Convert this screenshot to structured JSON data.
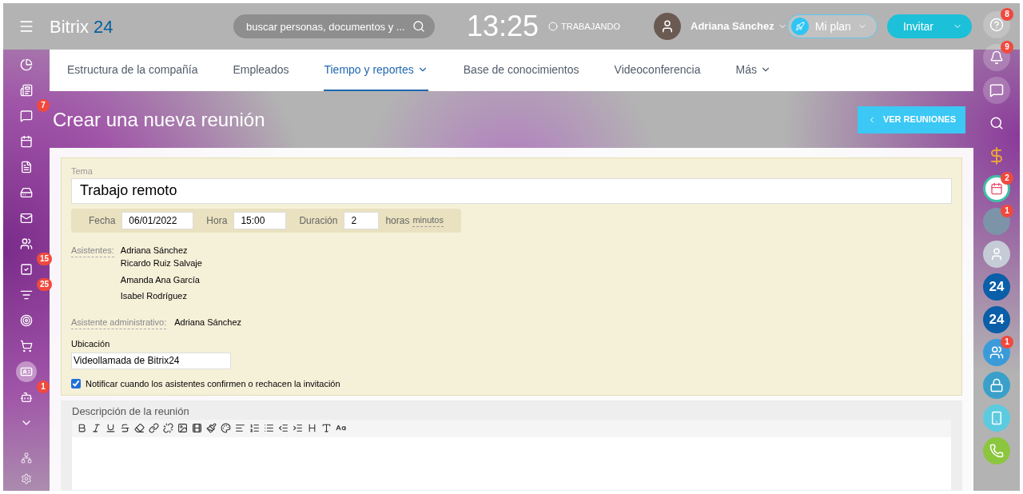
{
  "header": {
    "logo_text": "Bitrix",
    "logo_accent": "24",
    "search": {
      "placeholder": "buscar personas, documentos y ..."
    },
    "clock": "13:25",
    "status": "TRABAJANDO",
    "user": "Adriana Sánchez",
    "plan_button": "Mi plan",
    "invite_button": "Invitar"
  },
  "left_sidebar": {
    "items": [
      {
        "kind": "chart",
        "selected": false
      },
      {
        "kind": "feed",
        "selected": false
      },
      {
        "kind": "chat",
        "badge": "7",
        "selected": false
      },
      {
        "kind": "calendar",
        "selected": false
      },
      {
        "kind": "document",
        "selected": false
      },
      {
        "kind": "drive",
        "selected": false
      },
      {
        "kind": "mail",
        "selected": false
      },
      {
        "kind": "group",
        "selected": false
      },
      {
        "kind": "tasks",
        "badge": "15",
        "selected": false
      },
      {
        "kind": "filter",
        "badge": "25",
        "selected": false
      },
      {
        "kind": "target",
        "selected": false
      },
      {
        "kind": "cart",
        "selected": false
      },
      {
        "kind": "contact",
        "selected": true
      },
      {
        "kind": "robot",
        "badge": "1",
        "selected": false
      },
      {
        "kind": "more",
        "selected": false
      }
    ],
    "bottom": [
      {
        "kind": "network"
      },
      {
        "kind": "settings"
      }
    ]
  },
  "nav_tabs": [
    {
      "label": "Estructura de la compañía",
      "selected": false,
      "dropdown": false
    },
    {
      "label": "Empleados",
      "selected": false,
      "dropdown": false
    },
    {
      "label": "Tiempo y reportes",
      "selected": true,
      "dropdown": true
    },
    {
      "label": "Base de conocimientos",
      "selected": false,
      "dropdown": false
    },
    {
      "label": "Videoconferencia",
      "selected": false,
      "dropdown": false
    },
    {
      "label": "Más",
      "selected": false,
      "dropdown": true
    }
  ],
  "page_title": "Crear una nueva reunión",
  "view_button": "VER REUNIONES",
  "form": {
    "topic": {
      "label": "Tema",
      "value": "Trabajo remoto"
    },
    "date": {
      "label": "Fecha",
      "value": "06/01/2022"
    },
    "time": {
      "label": "Hora",
      "value": "15:00"
    },
    "duration": {
      "label": "Duración",
      "value": "2",
      "unit": "horas",
      "alt_unit": "minutos"
    },
    "attendees": {
      "label": "Asistentes:",
      "names": [
        "Adriana Sánchez",
        "Ricardo Ruiz Salvaje",
        "Amanda Ana García",
        "Isabel Rodríguez"
      ]
    },
    "assistant": {
      "label": "Asistente administrativo:",
      "value": "Adriana Sánchez"
    },
    "location": {
      "label": "Ubicación",
      "value": "Videollamada de Bitrix24"
    },
    "notify": {
      "label": "Notificar cuando los asistentes confirmen o rechacen la invitación",
      "checked": true
    },
    "description": {
      "label": "Descripción de la reunión"
    }
  },
  "right_sidebar": [
    {
      "kind": "help",
      "badge": "8"
    },
    {
      "kind": "bell",
      "badge": "9"
    },
    {
      "kind": "chat"
    },
    {
      "kind": "search"
    },
    {
      "kind": "dollar"
    },
    {
      "kind": "calendar",
      "badge": "2"
    },
    {
      "kind": "photo",
      "badge": "1"
    },
    {
      "kind": "avatar"
    },
    {
      "kind": "text",
      "text": "24"
    },
    {
      "kind": "text",
      "text": "24"
    },
    {
      "kind": "group",
      "badge": "1"
    },
    {
      "kind": "lock"
    },
    {
      "kind": "device"
    },
    {
      "kind": "phone"
    }
  ]
}
